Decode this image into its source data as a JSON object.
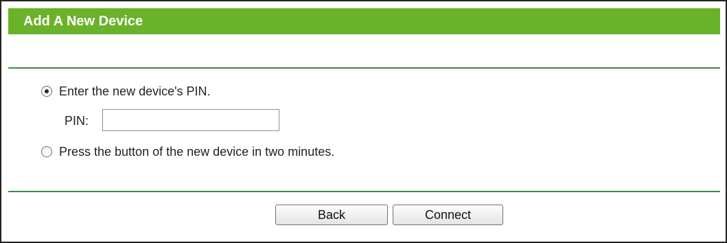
{
  "panel": {
    "title": "Add A New Device"
  },
  "options": {
    "pin_option": {
      "label": "Enter the new device's PIN.",
      "selected": true
    },
    "pbc_option": {
      "label": "Press the button of the new device in two minutes.",
      "selected": false
    }
  },
  "pin": {
    "label": "PIN:",
    "value": ""
  },
  "buttons": {
    "back_label": "Back",
    "connect_label": "Connect"
  },
  "colors": {
    "header_bg": "#6ab22a",
    "header_text": "#ffffff",
    "divider": "#3e8a3e"
  }
}
